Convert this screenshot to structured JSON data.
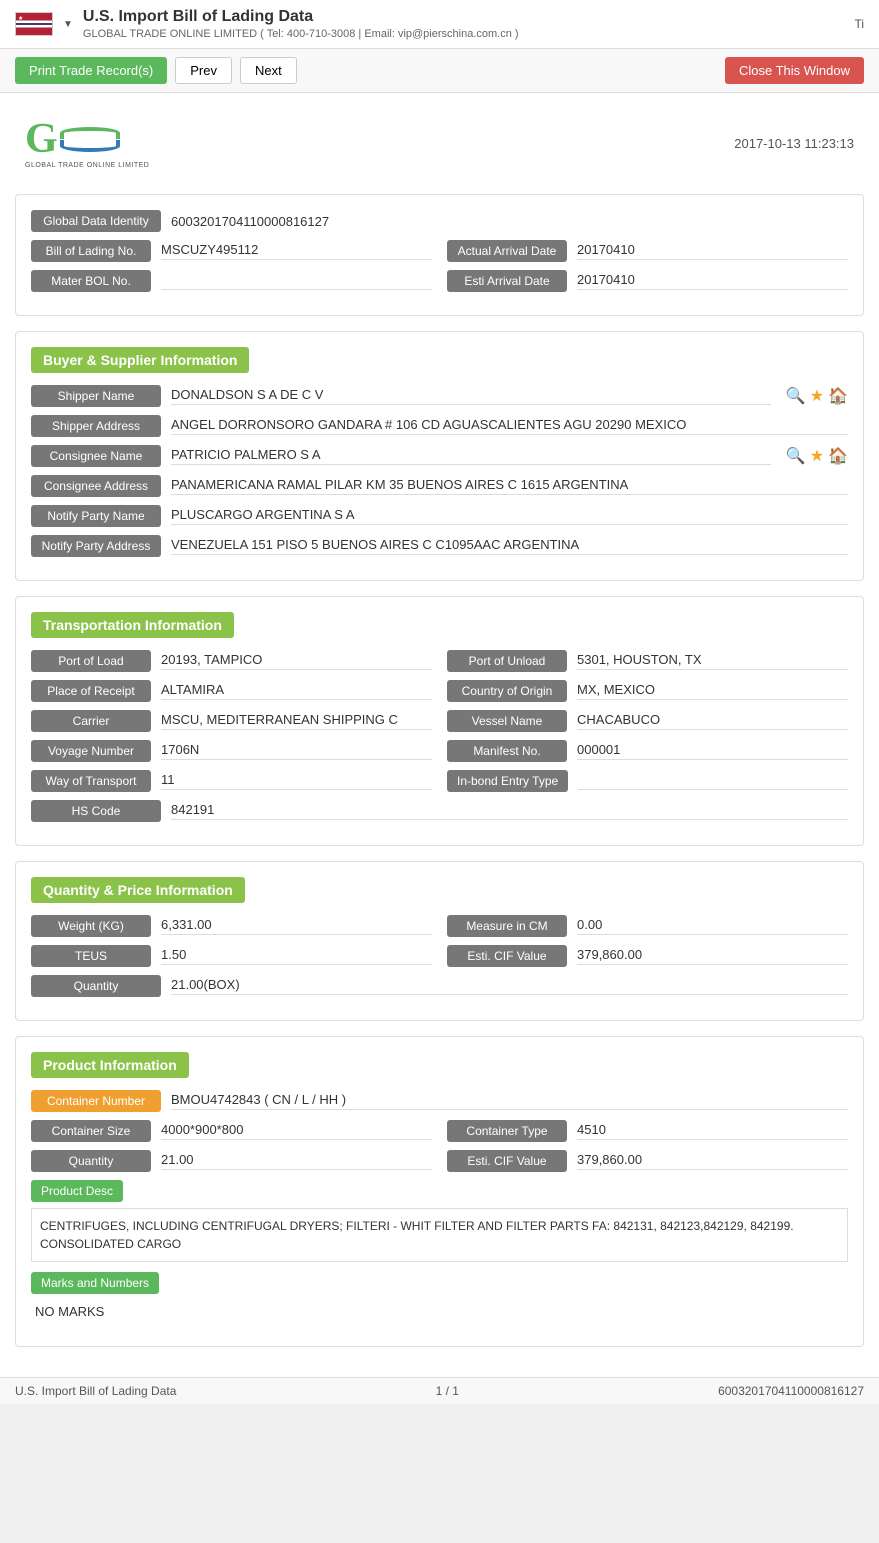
{
  "header": {
    "title": "U.S. Import Bill of Lading Data",
    "subtitle": "GLOBAL TRADE ONLINE LIMITED ( Tel: 400-710-3008 | Email: vip@pierschina.com.cn )",
    "right_text": "Ti"
  },
  "toolbar": {
    "print_label": "Print Trade Record(s)",
    "prev_label": "Prev",
    "next_label": "Next",
    "close_label": "Close This Window"
  },
  "logo": {
    "company": "GLOBAL TRADE ONLINE LIMITED",
    "datetime": "2017-10-13 11:23:13"
  },
  "identity": {
    "global_data_identity_label": "Global Data Identity",
    "global_data_identity_value": "6003201704110000816127",
    "bill_of_lading_label": "Bill of Lading No.",
    "bill_of_lading_value": "MSCUZY495112",
    "actual_arrival_label": "Actual Arrival Date",
    "actual_arrival_value": "20170410",
    "mater_bol_label": "Mater BOL No.",
    "mater_bol_value": "",
    "esti_arrival_label": "Esti Arrival Date",
    "esti_arrival_value": "20170410"
  },
  "buyer_supplier": {
    "section_title": "Buyer & Supplier Information",
    "shipper_name_label": "Shipper Name",
    "shipper_name_value": "DONALDSON S A DE C V",
    "shipper_address_label": "Shipper Address",
    "shipper_address_value": "ANGEL DORRONSORO GANDARA # 106 CD AGUASCALIENTES AGU 20290 MEXICO",
    "consignee_name_label": "Consignee Name",
    "consignee_name_value": "PATRICIO PALMERO S A",
    "consignee_address_label": "Consignee Address",
    "consignee_address_value": "PANAMERICANA RAMAL PILAR KM 35 BUENOS AIRES C 1615 ARGENTINA",
    "notify_party_name_label": "Notify Party Name",
    "notify_party_name_value": "PLUSCARGO ARGENTINA S A",
    "notify_party_address_label": "Notify Party Address",
    "notify_party_address_value": "VENEZUELA 151 PISO 5 BUENOS AIRES C C1095AAC ARGENTINA"
  },
  "transportation": {
    "section_title": "Transportation Information",
    "port_of_load_label": "Port of Load",
    "port_of_load_value": "20193, TAMPICO",
    "port_of_unload_label": "Port of Unload",
    "port_of_unload_value": "5301, HOUSTON, TX",
    "place_of_receipt_label": "Place of Receipt",
    "place_of_receipt_value": "ALTAMIRA",
    "country_of_origin_label": "Country of Origin",
    "country_of_origin_value": "MX, MEXICO",
    "carrier_label": "Carrier",
    "carrier_value": "MSCU, MEDITERRANEAN SHIPPING C",
    "vessel_name_label": "Vessel Name",
    "vessel_name_value": "CHACABUCO",
    "voyage_number_label": "Voyage Number",
    "voyage_number_value": "1706N",
    "manifest_no_label": "Manifest No.",
    "manifest_no_value": "000001",
    "way_of_transport_label": "Way of Transport",
    "way_of_transport_value": "11",
    "inbond_entry_label": "In-bond Entry Type",
    "inbond_entry_value": "",
    "hs_code_label": "HS Code",
    "hs_code_value": "842191"
  },
  "quantity_price": {
    "section_title": "Quantity & Price Information",
    "weight_label": "Weight (KG)",
    "weight_value": "6,331.00",
    "measure_label": "Measure in CM",
    "measure_value": "0.00",
    "teus_label": "TEUS",
    "teus_value": "1.50",
    "esti_cif_label": "Esti. CIF Value",
    "esti_cif_value": "379,860.00",
    "quantity_label": "Quantity",
    "quantity_value": "21.00(BOX)"
  },
  "product_info": {
    "section_title": "Product Information",
    "container_number_label": "Container Number",
    "container_number_value": "BMOU4742843 ( CN / L / HH )",
    "container_size_label": "Container Size",
    "container_size_value": "4000*900*800",
    "container_type_label": "Container Type",
    "container_type_value": "4510",
    "quantity_label": "Quantity",
    "quantity_value": "21.00",
    "esti_cif_label": "Esti. CIF Value",
    "esti_cif_value": "379,860.00",
    "product_desc_label": "Product Desc",
    "product_desc_value": "CENTRIFUGES, INCLUDING CENTRIFUGAL DRYERS; FILTERI - WHIT FILTER AND FILTER PARTS FA: 842131, 842123,842129, 842199.\nCONSOLIDATED CARGO",
    "marks_label": "Marks and Numbers",
    "marks_value": "NO MARKS"
  },
  "footer": {
    "left": "U.S. Import Bill of Lading Data",
    "center": "1 / 1",
    "right": "6003201704110000816127"
  }
}
